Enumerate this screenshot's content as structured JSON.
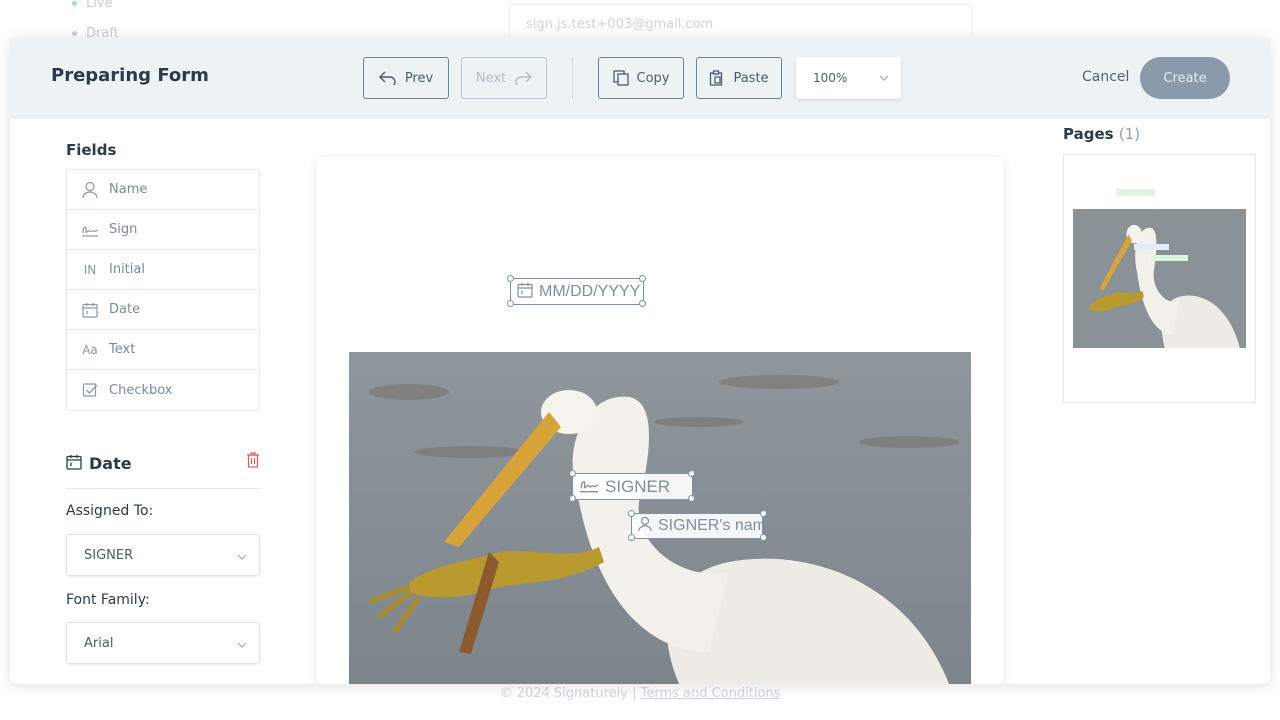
{
  "background": {
    "status_items": [
      {
        "label": "Live",
        "color": "#7ed6a0"
      },
      {
        "label": "Draft",
        "color": "#c7ced6"
      }
    ],
    "email_field_value": "sign.js.test+003@gmail.com",
    "footer_text": "© 2024 Signaturely |",
    "footer_link": "Terms and Conditions"
  },
  "header": {
    "title": "Preparing Form",
    "prev_label": "Prev",
    "next_label": "Next",
    "copy_label": "Copy",
    "paste_label": "Paste",
    "zoom_value": "100%",
    "cancel_label": "Cancel",
    "create_label": "Create"
  },
  "fields_panel": {
    "title": "Fields",
    "items": [
      {
        "label": "Name",
        "icon": "person-icon"
      },
      {
        "label": "Sign",
        "icon": "signature-icon"
      },
      {
        "label": "Initial",
        "icon": "initials-icon"
      },
      {
        "label": "Date",
        "icon": "calendar-icon"
      },
      {
        "label": "Text",
        "icon": "text-icon"
      },
      {
        "label": "Checkbox",
        "icon": "checkbox-icon"
      }
    ]
  },
  "properties": {
    "field_type": "Date",
    "assigned_to_label": "Assigned To:",
    "assigned_to_value": "SIGNER",
    "font_family_label": "Font Family:",
    "font_family_value": "Arial"
  },
  "document": {
    "date_field_placeholder": "MM/DD/YYYY",
    "sign_field_label": "SIGNER",
    "name_field_label": "SIGNER's nam"
  },
  "pages_panel": {
    "title": "Pages",
    "count": "(1)"
  },
  "colors": {
    "header_bg": "#edf2f5",
    "create_button": "#8a9aab",
    "delete_icon": "#e05a5a",
    "field_border": "#7f93a8"
  }
}
